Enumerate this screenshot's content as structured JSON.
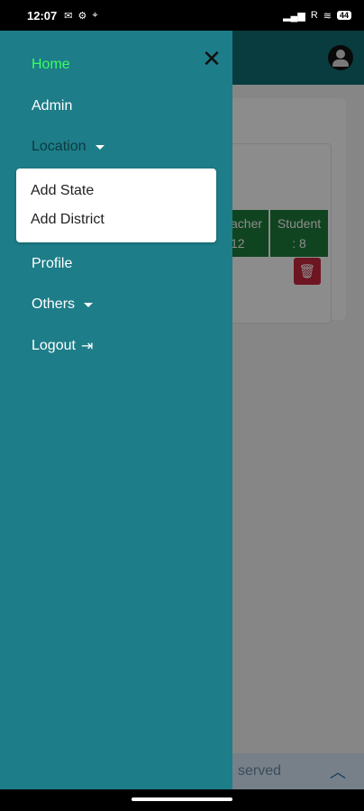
{
  "status": {
    "time": "12:07",
    "left_icons": [
      "gmail-icon",
      "gear-icon",
      "location-icon"
    ],
    "right_text": "R",
    "battery": "44"
  },
  "drawer": {
    "items": [
      {
        "label": "Home",
        "state": "active"
      },
      {
        "label": "Admin"
      },
      {
        "label": "Location",
        "has_dropdown": true
      },
      {
        "label": "Profile"
      },
      {
        "label": "Others",
        "has_dropdown": true
      },
      {
        "label": "Logout"
      }
    ],
    "location_dropdown": [
      "Add State",
      "Add District"
    ]
  },
  "background": {
    "stat_teacher": {
      "label": "acher",
      "value": "12"
    },
    "stat_student": {
      "label": "Student",
      "value": ": 8"
    },
    "footer_text": "served"
  },
  "colors": {
    "drawer": "#1d7d88",
    "active": "#39ff5f",
    "header": "#0f6d72"
  }
}
